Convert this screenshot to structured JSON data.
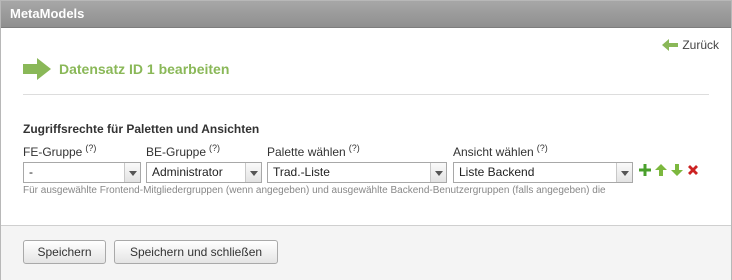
{
  "app": {
    "title": "MetaModels"
  },
  "nav": {
    "back_label": "Zurück"
  },
  "page": {
    "heading": "Datensatz ID 1 bearbeiten"
  },
  "section": {
    "title": "Zugriffsrechte für Paletten und Ansichten"
  },
  "fields": {
    "fe_group": {
      "label": "FE-Gruppe",
      "help": "(?)",
      "value": "-"
    },
    "be_group": {
      "label": "BE-Gruppe",
      "help": "(?)",
      "value": "Administrator"
    },
    "palette": {
      "label": "Palette wählen",
      "help": "(?)",
      "value": "Trad.-Liste"
    },
    "view": {
      "label": "Ansicht wählen",
      "help": "(?)",
      "value": "Liste Backend"
    }
  },
  "description": "Für ausgewählte Frontend-Mitgliedergruppen (wenn angegeben) und ausgewählte Backend-Benutzergruppen (falls angegeben) die",
  "footer": {
    "save_label": "Speichern",
    "save_close_label": "Speichern und schließen"
  },
  "colors": {
    "accent_green": "#8ab858",
    "titlebar": "#999999",
    "delete_red": "#cc2222"
  }
}
